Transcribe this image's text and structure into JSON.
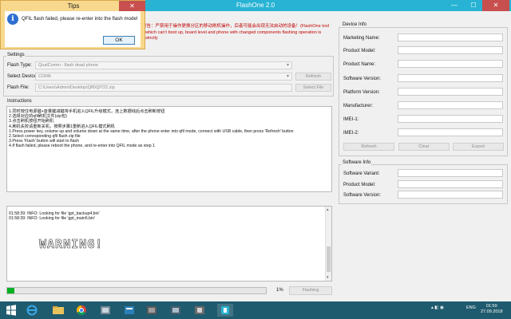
{
  "window": {
    "title": "FlashOne 2.0",
    "min": "—",
    "max": "☐",
    "close": "✕"
  },
  "warning": {
    "line1": "警告：严禁用于操作更换分区的移动刷机操作，后者可能会出现无法启动的设备！(FlashOne tool",
    "line2": "which can't boot up, board level and phone with changed components flashing operation is strictly"
  },
  "dialog": {
    "title": "Tips",
    "close": "✕",
    "message": "QFIL flash failed, please re-enter into the flash mode!",
    "ok_label": "OK"
  },
  "settings": {
    "title": "Settings",
    "flash_type_label": "Flash Type:",
    "flash_type_value": "QualComm - flash dead phone",
    "device_label": "Select Device:",
    "device_value": "COM6",
    "refresh_label": "Refresh",
    "flash_file_label": "Flash File:",
    "flash_file_value": "C:\\Users\\Admin\\Desktop\\Qf6\\Qf722.zip",
    "select_file_label": "Select File"
  },
  "instructions": {
    "title": "Instructions",
    "lines": [
      "1.同时按住电源键+音量键减键将手机进入QFIL升级模式，连上数据线后点击刷新按钮",
      "2.选择对应的qfil刷机文件(zip包)",
      "3.点击刷机按钮开始刷机",
      "4.刷机失败请重新关机，按照步骤1重新进入QFIL模式刷机",
      "1.Press power key, volume up and volume down at the same time, after the phone enter into qfil mode, connect with USB cable, then press 'Refresh' button",
      "2.Select corresponding qfil flash zip file",
      "3.Press 'Flash' button will start to flash",
      "4.If flash failed, please reboot the phone, and re-enter into QFIL mode as step 1"
    ]
  },
  "log": {
    "lines": [
      "01:58:39: INFO: Looking for file 'gpt_backup4.bin'",
      "01:58:39: INFO: Looking for file 'gpt_main5.bin'"
    ],
    "watermark": "WARNING!"
  },
  "progress": {
    "percent_text": "1%",
    "fraction": 0.01,
    "flashing_label": "Flashing"
  },
  "device_info": {
    "title": "Device Info",
    "fields": [
      "Marketing Name:",
      "Product Model:",
      "Product Name:",
      "Software Version:",
      "Platform Version:",
      "Manufacturer:",
      "IMEI-1:",
      "IMEI-2:"
    ],
    "buttons": [
      "Refresh",
      "Clear",
      "Export"
    ]
  },
  "software_info": {
    "title": "Software Info",
    "fields": [
      "Software Variant:",
      "Product Model:",
      "Software Version:"
    ]
  },
  "taskbar": {
    "language": "ENG",
    "time": "01:59",
    "date": "27.09.2018"
  },
  "colors": {
    "titlebar": "#28b3d4",
    "close": "#c7504f",
    "dialog": "#f8d88d",
    "progress": "#06b025",
    "warning_text": "#c00000"
  }
}
